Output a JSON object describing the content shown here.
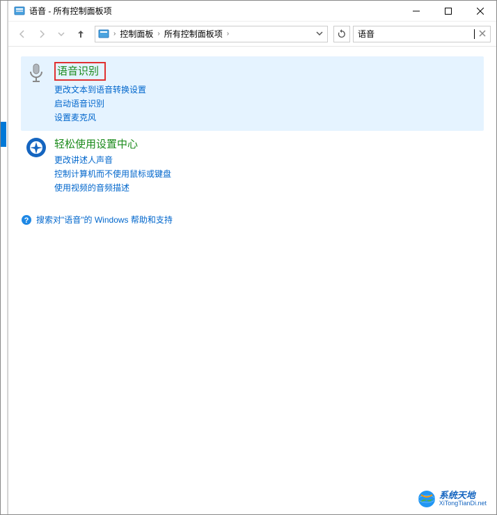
{
  "window": {
    "title": "语音 - 所有控制面板项"
  },
  "breadcrumb": {
    "item1": "控制面板",
    "item2": "所有控制面板项"
  },
  "search": {
    "value": "语音"
  },
  "results": [
    {
      "title": "语音识别",
      "links": [
        "更改文本到语音转换设置",
        "启动语音识别",
        "设置麦克风"
      ]
    },
    {
      "title": "轻松使用设置中心",
      "links": [
        "更改讲述人声音",
        "控制计算机而不使用鼠标或键盘",
        "使用视频的音频描述"
      ]
    }
  ],
  "help": {
    "text": "搜索对\"语音\"的 Windows 帮助和支持"
  },
  "watermark": {
    "cn": "系统天地",
    "en": "XiTongTianDi.net"
  }
}
